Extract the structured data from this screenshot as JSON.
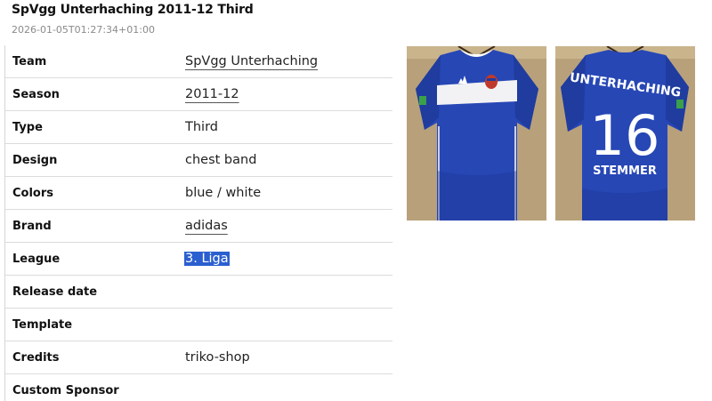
{
  "header": {
    "title": "SpVgg Unterhaching 2011-12 Third",
    "timestamp": "2026-01-05T01:27:34+01:00"
  },
  "details": {
    "rows": [
      {
        "label": "Team",
        "value": "SpVgg Unterhaching"
      },
      {
        "label": "Season",
        "value": "2011-12"
      },
      {
        "label": "Type",
        "value": "Third"
      },
      {
        "label": "Design",
        "value": "chest band"
      },
      {
        "label": "Colors",
        "value": "blue / white"
      },
      {
        "label": "Brand",
        "value": "adidas"
      },
      {
        "label": "League",
        "value": "3. Liga"
      },
      {
        "label": "Release date",
        "value": ""
      },
      {
        "label": "Template",
        "value": ""
      },
      {
        "label": "Credits",
        "value": "triko-shop"
      },
      {
        "label": "Custom Sponsor",
        "value": ""
      }
    ]
  },
  "photos": {
    "back_name": "UNTERHACHING",
    "back_number": "16",
    "back_player": "STEMMER",
    "colors": {
      "background": "#b8a17a",
      "shirt": "#2747b5",
      "band": "#f2f2f4",
      "hanger": "#3a2a18"
    }
  },
  "colors": {
    "selection": "#2b5fd0",
    "border": "#dcdcdc",
    "timestamp": "#8a8a8a"
  }
}
